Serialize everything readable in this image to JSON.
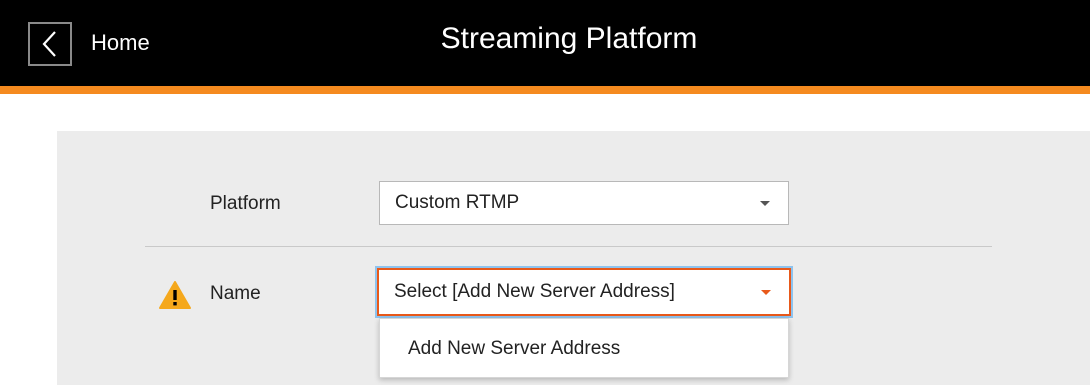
{
  "header": {
    "home_label": "Home",
    "title": "Streaming Platform",
    "back_icon": "chevron-left-icon",
    "accent_color": "#f58a1f"
  },
  "form": {
    "platform": {
      "label": "Platform",
      "value": "Custom RTMP",
      "caret_color": "#555555"
    },
    "name": {
      "label": "Name",
      "value": "Select [Add New Server Address]",
      "warning_icon": "warning-icon",
      "caret_color": "#e8591a",
      "focus_color": "#e8591a"
    }
  },
  "dropdown": {
    "options": [
      "Add New Server Address"
    ]
  }
}
